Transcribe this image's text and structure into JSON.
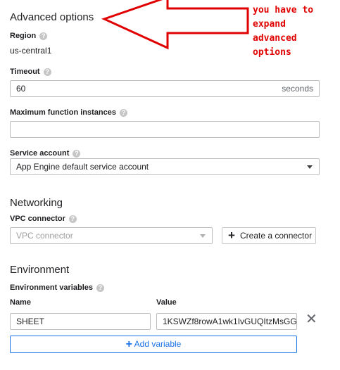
{
  "advanced": {
    "title": "Advanced options"
  },
  "annotation": {
    "lines": [
      "you have to",
      "expand",
      "advanced",
      "options"
    ]
  },
  "region": {
    "label": "Region",
    "value": "us-central1"
  },
  "timeout": {
    "label": "Timeout",
    "value": "60",
    "suffix": "seconds"
  },
  "max_instances": {
    "label": "Maximum function instances",
    "value": ""
  },
  "service_account": {
    "label": "Service account",
    "value": "App Engine default service account"
  },
  "networking": {
    "title": "Networking",
    "vpc_label": "VPC connector",
    "vpc_placeholder": "VPC connector",
    "create_button": "Create a connector"
  },
  "environment": {
    "title": "Environment",
    "vars_label": "Environment variables",
    "name_header": "Name",
    "value_header": "Value",
    "rows": [
      {
        "name": "SHEET",
        "value": "1KSWZf8rowA1wk1IvGUQItzMsGG"
      }
    ],
    "add_button": "Add variable"
  },
  "colors": {
    "annotation": "#e00000",
    "accent": "#1a73e8",
    "help": "#c6c6c6"
  },
  "icons": {
    "help": "help-icon",
    "dropdown": "chevron-down-icon",
    "plus": "plus-icon",
    "close": "close-icon"
  }
}
